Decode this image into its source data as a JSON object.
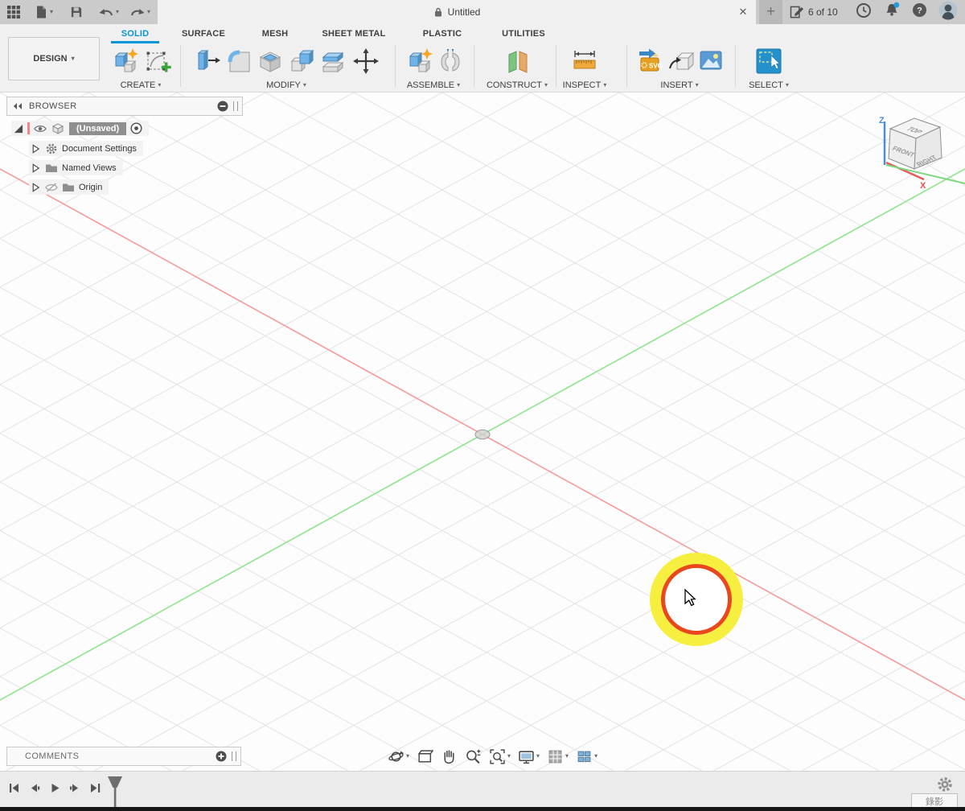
{
  "glyphs": {
    "caret": "▾",
    "close": "✕",
    "plus": "+",
    "help": "?"
  },
  "titlebar": {
    "document_title": "Untitled",
    "doc_pager": "6 of 10"
  },
  "ribbon": {
    "design_label": "DESIGN",
    "tabs": [
      "SOLID",
      "SURFACE",
      "MESH",
      "SHEET METAL",
      "PLASTIC",
      "UTILITIES"
    ],
    "active_tab": "SOLID",
    "groups": [
      "CREATE",
      "MODIFY",
      "ASSEMBLE",
      "CONSTRUCT",
      "INSPECT",
      "INSERT",
      "SELECT"
    ],
    "insert_svg_badge": "SVG"
  },
  "browser": {
    "header": "BROWSER",
    "root_label": "(Unsaved)",
    "items": [
      "Document Settings",
      "Named Views",
      "Origin"
    ]
  },
  "viewcube": {
    "top": "TOP",
    "front": "FRONT",
    "right": "RIGHT",
    "axis_z": "Z",
    "axis_x": "X"
  },
  "comments": {
    "label": "COMMENTS"
  },
  "overlay": {
    "recording_label": "錄影"
  },
  "colors": {
    "accent_blue": "#0696d7",
    "axis_x_red": "#f59b9b",
    "axis_y_green": "#90e590",
    "viewcube_z_blue": "#4a90d9",
    "highlight_yellow": "#f7ee35",
    "highlight_ring_orange": "#e8481c",
    "notification_badge": "#1f9cd9"
  },
  "icons": {
    "app-menu-icon": "grid-3x3",
    "file-icon": "document",
    "save-icon": "floppy-disk",
    "undo-icon": "arrow-curl-left",
    "redo-icon": "arrow-curl-right",
    "lock-icon": "padlock",
    "doc-pager-icon": "document-pencil",
    "extensions-icon": "clock",
    "notifications-icon": "bell-with-badge",
    "help-icon": "question-circle",
    "avatar-icon": "person-silhouette",
    "browser-collapse-icon": "double-chevron-left",
    "hide-icon": "minus-circle",
    "add-comment-icon": "plus-circle",
    "orbit-icon": "orbit-sphere",
    "look-at-icon": "look-at-plane",
    "pan-icon": "hand",
    "zoom-icon": "magnifier-plus-minus",
    "fit-icon": "magnifier-fit",
    "display-settings-icon": "monitor",
    "grid-settings-icon": "grid",
    "viewports-icon": "four-panes",
    "settings-gear-icon": "gear",
    "timeline-marker-icon": "position-flag"
  }
}
